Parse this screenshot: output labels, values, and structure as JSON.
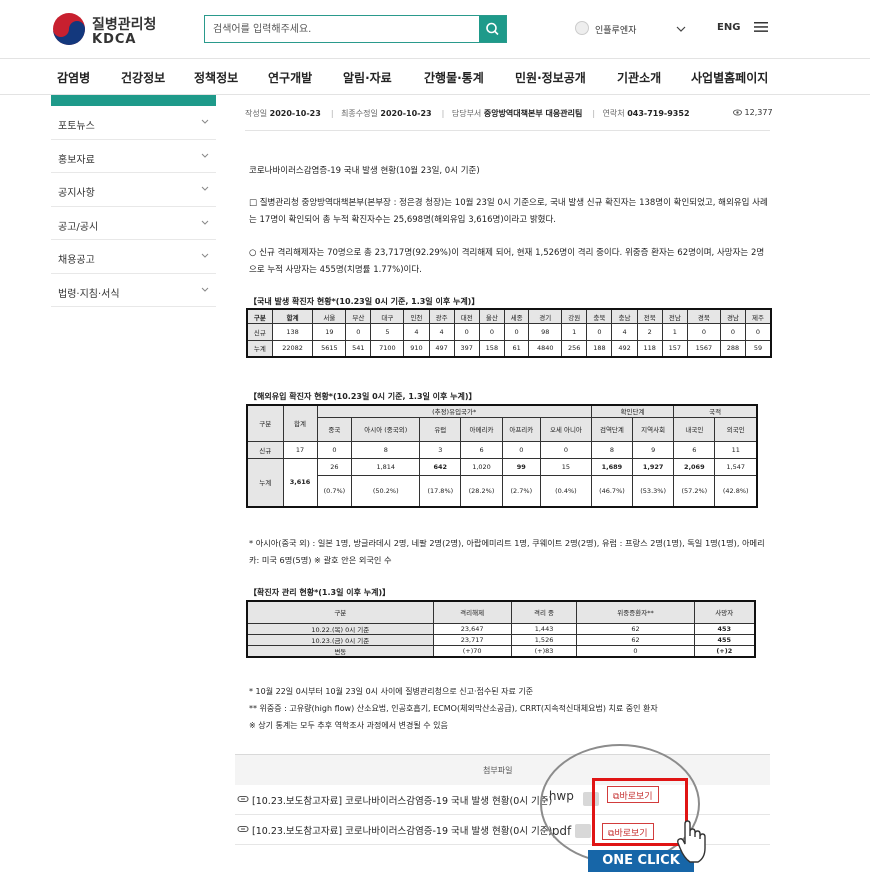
{
  "header": {
    "logo_ko": "질병관리청",
    "logo_en": "KDCA",
    "search_placeholder": "검색어를 입력해주세요.",
    "influenza_label": "인플루엔자",
    "lang_label": "ENG"
  },
  "gnb": [
    "감염병",
    "건강정보",
    "정책정보",
    "연구개발",
    "알림·자료",
    "간행물·통계",
    "민원·정보공개",
    "기관소개",
    "사업별홈페이지"
  ],
  "sidebar": [
    "포토뉴스",
    "홍보자료",
    "공지사항",
    "공고/공시",
    "채용공고",
    "법령·지침·서식"
  ],
  "meta": {
    "created_label": "작성일",
    "created": "2020-10-23",
    "modified_label": "최종수정일",
    "modified": "2020-10-23",
    "dept_label": "담당부서",
    "dept": "중앙방역대책본부 대응관리팀",
    "phone_label": "연락처",
    "phone": "043-719-9352",
    "views": "12,377"
  },
  "article": {
    "headline": "코로나바이러스감염증-19 국내 발생 현황(10월 23일, 0시 기준)",
    "para1": "□ 질병관리청 중앙방역대책본부(본부장 : 정은경 청장)는 10월 23일 0시 기준으로, 국내 발생 신규 확진자는 138명이 확인되었고, 해외유입 사례는 17명이 확인되어 총 누적 확진자수는 25,698명(해외유입 3,616명)이라고 밝혔다.",
    "para2": "○ 신규 격리해제자는 70명으로 총 23,717명(92.29%)이 격리해제 되어, 현재 1,526명이 격리 중이다. 위중증 환자는 62명이며, 사망자는 2명으로 누적 사망자는 455명(치명률 1.77%)이다.",
    "note1": "* 아시아(중국 외) : 일본 1명, 방글라데시 2명, 네팔 2명(2명), 아랍에미리트 1명, 쿠웨이트 2명(2명), 유럽 : 프랑스 2명(1명), 독일 1명(1명), 아메리카: 미국 6명(5명) ※ 괄호 안은 외국인 수",
    "footnotes": [
      "* 10월 22일 0시부터 10월 23일 0시 사이에 질병관리청으로 신고·접수된 자료 기준",
      "** 위중증 : 고유량(high flow) 산소요법, 인공호흡기, ECMO(체외막산소공급), CRRT(지속적신대체요법) 치료 중인 환자",
      "※ 상기 통계는 모두 추후 역학조사 과정에서 변경될 수 있음"
    ]
  },
  "table1": {
    "caption": "【국내 발생 확진자 현황*(10.23일 0시 기준, 1.3일 이후 누계)】",
    "headers": [
      "구분",
      "합계",
      "서울",
      "부산",
      "대구",
      "인천",
      "광주",
      "대전",
      "울산",
      "세종",
      "경기",
      "강원",
      "충북",
      "충남",
      "전북",
      "전남",
      "경북",
      "경남",
      "제주"
    ],
    "rows": [
      [
        "신규",
        "138",
        "19",
        "0",
        "5",
        "4",
        "4",
        "0",
        "0",
        "0",
        "98",
        "1",
        "0",
        "4",
        "2",
        "1",
        "0",
        "0",
        "0"
      ],
      [
        "누계",
        "22082",
        "5615",
        "541",
        "7100",
        "910",
        "497",
        "397",
        "158",
        "61",
        "4840",
        "256",
        "188",
        "492",
        "118",
        "157",
        "1567",
        "288",
        "59"
      ]
    ]
  },
  "table2": {
    "caption": "【해외유입 확진자 현황*(10.23일 0시 기준, 1.3일 이후 누계)】",
    "h_gubun": "구분",
    "h_total": "합계",
    "h_origin": "(추정)유입국가*",
    "h_confirm": "확인단계",
    "h_nation": "국적",
    "sub": [
      "중국",
      "아시아 (중국외)",
      "유럽",
      "아메리카",
      "아프리카",
      "오세 아니아",
      "검역단계",
      "지역사회",
      "내국인",
      "외국인"
    ],
    "new_label": "신규",
    "new_total": "17",
    "new": [
      "0",
      "8",
      "3",
      "6",
      "0",
      "0",
      "8",
      "9",
      "6",
      "11"
    ],
    "cum_label": "누계",
    "cum_total": "3,616",
    "cum": [
      "26",
      "1,814",
      "642",
      "1,020",
      "99",
      "15",
      "1,689",
      "1,927",
      "2,069",
      "1,547"
    ],
    "cum_pct": [
      "(0.7%)",
      "(50.2%)",
      "(17.8%)",
      "(28.2%)",
      "(2.7%)",
      "(0.4%)",
      "(46.7%)",
      "(53.3%)",
      "(57.2%)",
      "(42.8%)"
    ]
  },
  "table3": {
    "caption": "【확진자 관리 현황*(1.3일 이후 누계)】",
    "headers": [
      "구분",
      "격리해제",
      "격리 중",
      "위중증환자**",
      "사망자"
    ],
    "rows": [
      [
        "10.22.(목) 0시 기준",
        "23,647",
        "1,443",
        "62",
        "453"
      ],
      [
        "10.23.(금) 0시 기준",
        "23,717",
        "1,526",
        "62",
        "455"
      ],
      [
        "변동",
        "(+)70",
        "(+)83",
        "0",
        "(+)2"
      ]
    ]
  },
  "attachments": {
    "title": "첨부파일",
    "files": [
      {
        "name": "[10.23.보도참고자료] 코로나바이러스감염증-19 국내 발생 현황(0시 기준)",
        "ext": ".hwp",
        "view": "바로보기"
      },
      {
        "name": "[10.23.보도참고자료] 코로나바이러스감염증-19 국내 발생 현황(0시 기준)",
        "ext": ".pdf",
        "view": "바로보기"
      }
    ],
    "one_click": "ONE CLICK"
  }
}
